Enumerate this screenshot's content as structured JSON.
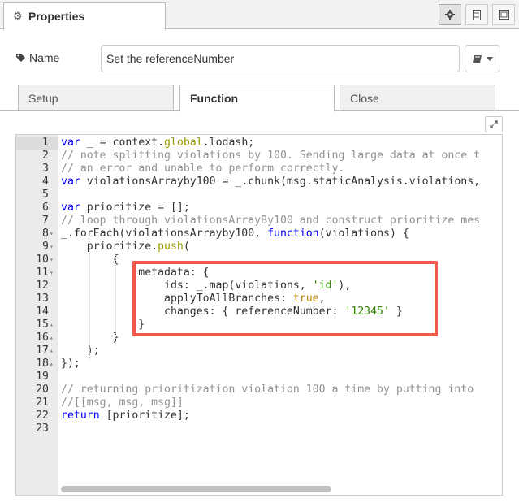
{
  "header": {
    "tab_label": "Properties",
    "icons": [
      "gear-icon",
      "document-icon",
      "layout-icon"
    ]
  },
  "name_field": {
    "label": "Name",
    "value": "Set the referenceNumber",
    "icon_button": "book-icon"
  },
  "tabs": [
    {
      "label": "Setup",
      "active": false
    },
    {
      "label": "Function",
      "active": true
    },
    {
      "label": "Close",
      "active": false
    }
  ],
  "editor": {
    "lines": [
      {
        "n": "1",
        "fold": "",
        "html": "<span class=\"t-kw\">var</span> _ = context.<span class=\"t-bi\">global</span>.lodash;"
      },
      {
        "n": "2",
        "fold": "",
        "html": "<span class=\"t-cm\">// note splitting violations by 100. Sending large data at once t</span>"
      },
      {
        "n": "3",
        "fold": "",
        "html": "<span class=\"t-cm\">// an error and unable to perform correctly.</span>"
      },
      {
        "n": "4",
        "fold": "",
        "html": "<span class=\"t-kw\">var</span> violationsArrayby100 = _.chunk(msg.staticAnalysis.violations,"
      },
      {
        "n": "5",
        "fold": "",
        "html": ""
      },
      {
        "n": "6",
        "fold": "",
        "html": "<span class=\"t-kw\">var</span> prioritize = [];"
      },
      {
        "n": "7",
        "fold": "",
        "html": "<span class=\"t-cm\">// loop through violationsArrayBy100 and construct prioritize mes</span>"
      },
      {
        "n": "8",
        "fold": "▾",
        "html": "_.forEach(violationsArrayby100, <span class=\"t-kw\">function</span>(violations) {"
      },
      {
        "n": "9",
        "fold": "▾",
        "html": "    prioritize.<span class=\"t-bi\">push</span>("
      },
      {
        "n": "10",
        "fold": "▾",
        "html": "        {"
      },
      {
        "n": "11",
        "fold": "▾",
        "html": "            metadata: {"
      },
      {
        "n": "12",
        "fold": "",
        "html": "                ids: _.map(violations, <span class=\"t-str\">'id'</span>),"
      },
      {
        "n": "13",
        "fold": "",
        "html": "                applyToAllBranches: <span class=\"t-bool\">true</span>,"
      },
      {
        "n": "14",
        "fold": "",
        "html": "                changes: { referenceNumber: <span class=\"t-str\">'12345'</span> }"
      },
      {
        "n": "15",
        "fold": "▴",
        "html": "            }"
      },
      {
        "n": "16",
        "fold": "▴",
        "html": "        }"
      },
      {
        "n": "17",
        "fold": "▴",
        "html": "    );"
      },
      {
        "n": "18",
        "fold": "▴",
        "html": "});"
      },
      {
        "n": "19",
        "fold": "",
        "html": ""
      },
      {
        "n": "20",
        "fold": "",
        "html": "<span class=\"t-cm\">// returning prioritization violation 100 a time by putting into</span>"
      },
      {
        "n": "21",
        "fold": "",
        "html": "<span class=\"t-cm\">//[[msg, msg, msg]]</span>"
      },
      {
        "n": "22",
        "fold": "",
        "html": "<span class=\"t-kw\">return</span> [prioritize];"
      },
      {
        "n": "23",
        "fold": "",
        "html": ""
      }
    ]
  },
  "colors": {
    "highlight_box": "#ef5a4f",
    "keyword": "#0000ff",
    "comment": "#919191",
    "string": "#2c8a00"
  }
}
